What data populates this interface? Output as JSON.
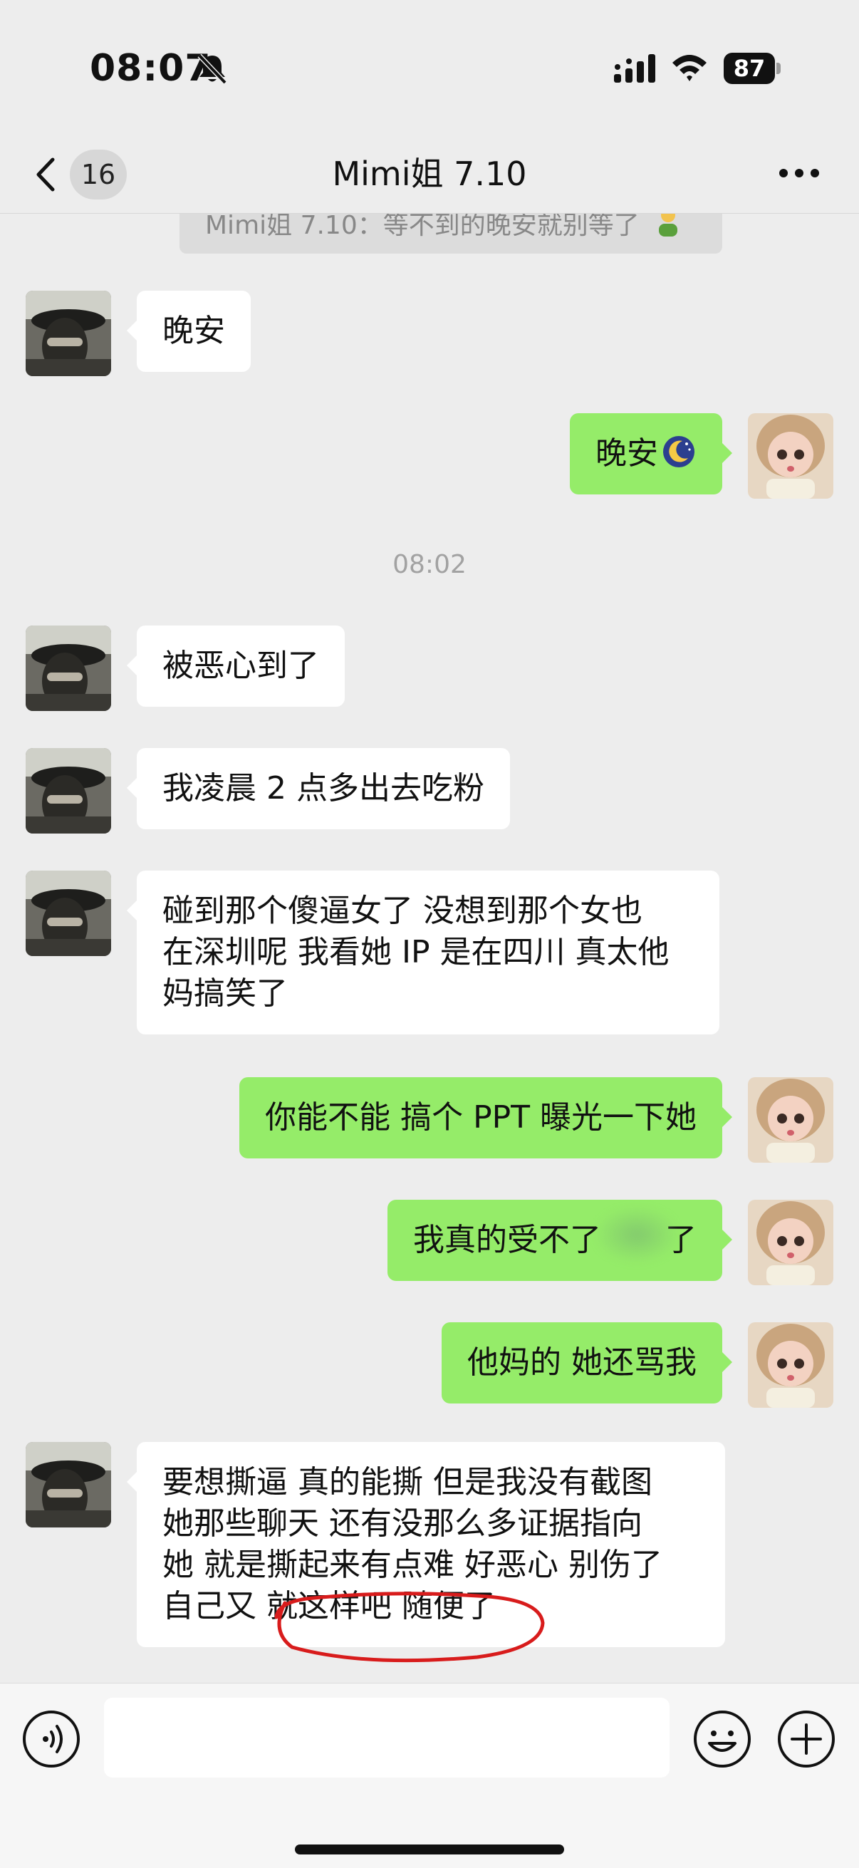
{
  "status_bar": {
    "time": "08:07",
    "battery": "87",
    "icons": [
      "bell-slash-icon",
      "signal-icon",
      "wifi-icon",
      "battery-icon"
    ]
  },
  "nav": {
    "unread_count": "16",
    "title": "Mimi姐 7.10",
    "icons": [
      "chevron-left-icon",
      "more-dots-icon"
    ]
  },
  "quote": {
    "text": "Mimi姐 7.10：等不到的晚安就别等了"
  },
  "timestamp": "08:02",
  "messages": [
    {
      "side": "in",
      "lines": [
        "晚安"
      ]
    },
    {
      "side": "out",
      "lines": [
        "晚安"
      ],
      "emoji": "moon-sleep-emoji"
    },
    {
      "side": "in",
      "lines": [
        "被恶心到了"
      ]
    },
    {
      "side": "in",
      "lines": [
        "我凌晨 2 点多出去吃粉"
      ]
    },
    {
      "side": "in",
      "lines": [
        "碰到那个傻逼女了 没想到那个女也",
        "在深圳呢 我看她 IP 是在四川 真太他",
        "妈搞笑了"
      ]
    },
    {
      "side": "out",
      "lines": [
        "你能不能 搞个 PPT 曝光一下她"
      ]
    },
    {
      "side": "out",
      "lines": [
        "我真的受不了",
        "了"
      ],
      "note": "partially blurred"
    },
    {
      "side": "out",
      "lines": [
        "他妈的 她还骂我"
      ]
    },
    {
      "side": "in",
      "lines": [
        "要想撕逼 真的能撕 但是我没有截图",
        "她那些聊天 还有没那么多证据指向",
        "她 就是撕起来有点难 好恶心 别伤了",
        "自己又 就这样吧 随便了"
      ]
    }
  ],
  "colors": {
    "background": "#ededed",
    "bubble_in": "#ffffff",
    "bubble_out": "#95ec69",
    "annotation": "#d81c1c"
  },
  "input_bar": {
    "placeholder": "",
    "icons": [
      "voice-icon",
      "emoji-smile-icon",
      "plus-icon"
    ]
  }
}
